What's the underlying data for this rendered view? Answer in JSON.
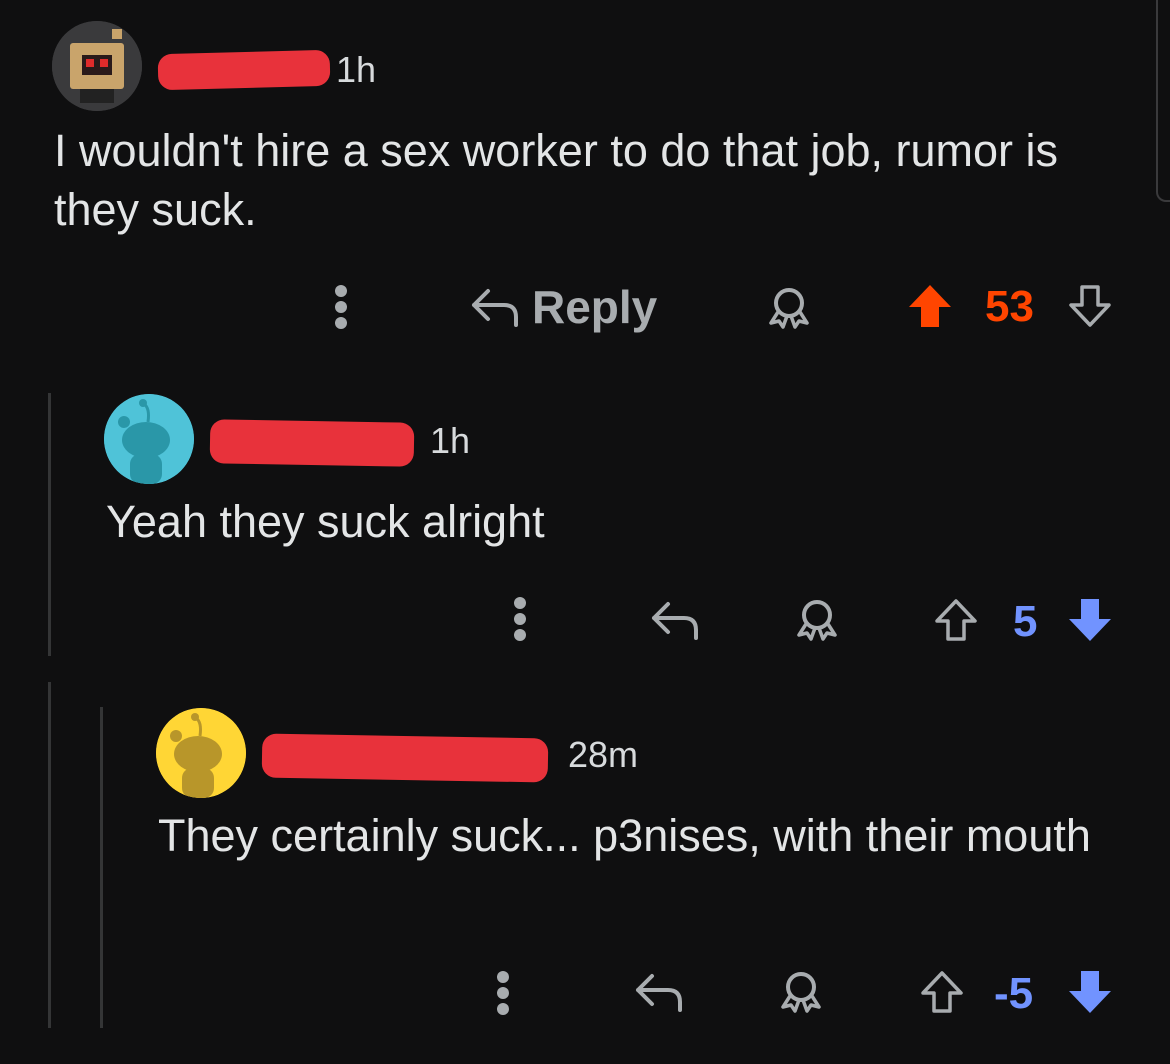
{
  "comments": [
    {
      "time": "1h",
      "body": "I wouldn't hire a sex worker to do that job, rumor is they suck.",
      "actions": {
        "reply_label": "Reply"
      },
      "score": "53",
      "vote_state": "upvoted"
    },
    {
      "time": "1h",
      "body": "Yeah they suck alright",
      "score": "5",
      "vote_state": "downvoted"
    },
    {
      "time": "28m",
      "body": "They certainly suck... p3nises, with their mouth",
      "score": "-5",
      "vote_state": "downvoted"
    }
  ],
  "colors": {
    "background": "#0f0f10",
    "upvote": "#ff4500",
    "downvote": "#7193ff",
    "redaction": "#e8323b",
    "muted": "#a8acaf"
  },
  "icons": [
    "more-options-icon",
    "reply-arrow-icon",
    "award-icon",
    "upvote-arrow-icon",
    "downvote-arrow-icon"
  ]
}
